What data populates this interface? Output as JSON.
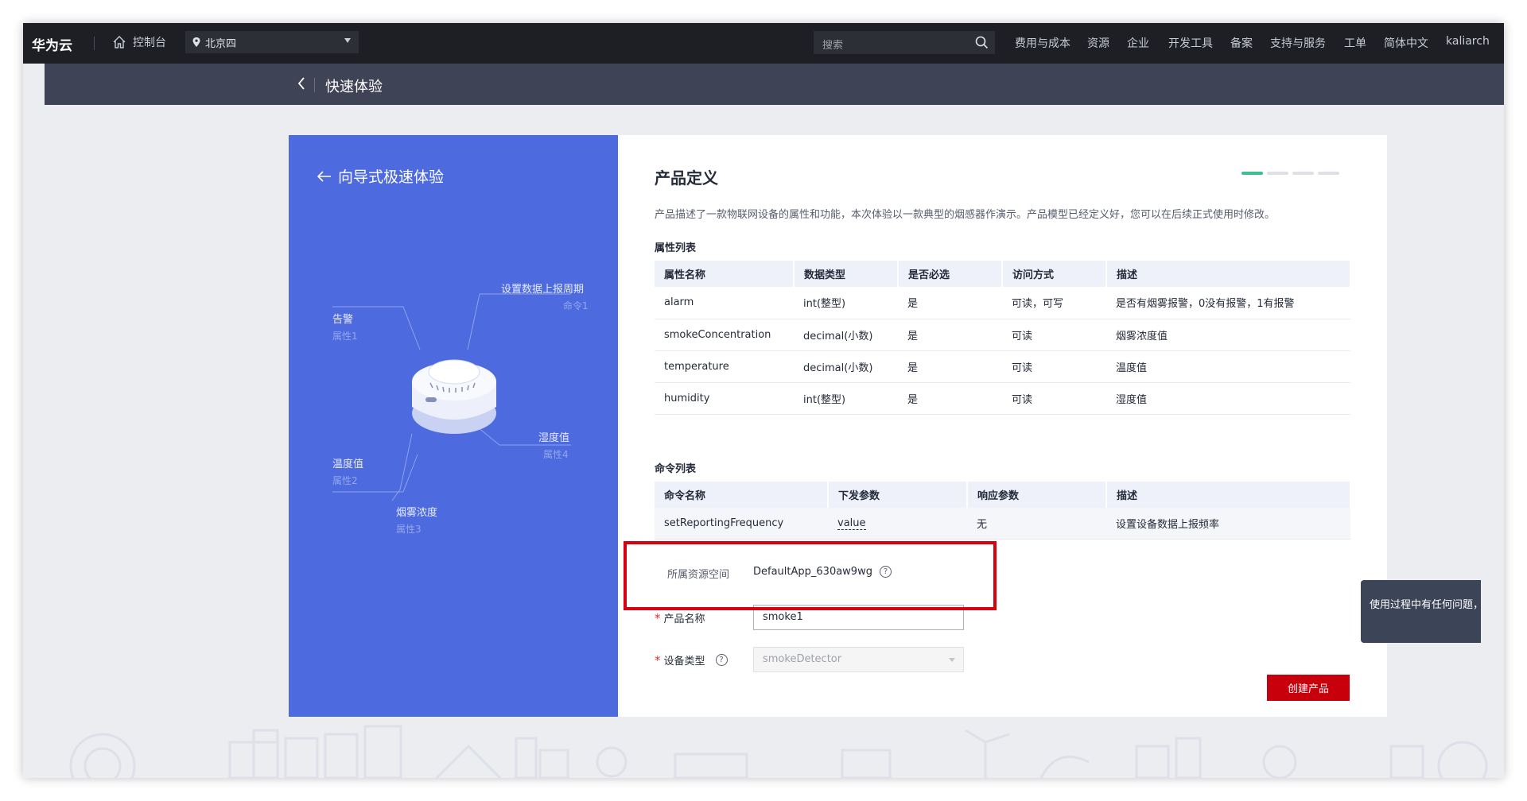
{
  "topbar": {
    "logo": "华为云",
    "console": "控制台",
    "region": "北京四",
    "search_placeholder": "搜索",
    "nav": [
      "费用与成本",
      "资源",
      "企业",
      "开发工具",
      "备案",
      "支持与服务",
      "工单",
      "简体中文",
      "kaliarch"
    ]
  },
  "subbar": {
    "title": "快速体验"
  },
  "left": {
    "title": "向导式极速体验",
    "diagram": {
      "set_period": "设置数据上报周期",
      "cmd1": "命令1",
      "alarm": "告警",
      "attr1": "属性1",
      "humidity": "湿度值",
      "attr4": "属性4",
      "temperature": "温度值",
      "attr2": "属性2",
      "smoke": "烟雾浓度",
      "attr3": "属性3"
    }
  },
  "product": {
    "title": "产品定义",
    "description": "产品描述了一款物联网设备的属性和功能，本次体验以一款典型的烟感器作演示。产品模型已经定义好，您可以在后续正式使用时修改。",
    "attr_section": "属性列表",
    "attr_headers": [
      "属性名称",
      "数据类型",
      "是否必选",
      "访问方式",
      "描述"
    ],
    "attr_rows": [
      [
        "alarm",
        "int(整型)",
        "是",
        "可读，可写",
        "是否有烟雾报警，0没有报警，1有报警"
      ],
      [
        "smokeConcentration",
        "decimal(小数)",
        "是",
        "可读",
        "烟雾浓度值"
      ],
      [
        "temperature",
        "decimal(小数)",
        "是",
        "可读",
        "温度值"
      ],
      [
        "humidity",
        "int(整型)",
        "是",
        "可读",
        "湿度值"
      ]
    ],
    "cmd_section": "命令列表",
    "cmd_headers": [
      "命令名称",
      "下发参数",
      "响应参数",
      "描述"
    ],
    "cmd_rows": [
      [
        "setReportingFrequency",
        "value",
        "无",
        "设置设备数据上报频率"
      ]
    ]
  },
  "form": {
    "resource_space_label": "所属资源空间",
    "resource_space_value": "DefaultApp_630aw9wg",
    "product_name_label": "产品名称",
    "product_name_value": "smoke1",
    "device_type_label": "设备类型",
    "device_type_value": "smokeDetector",
    "create_button": "创建产品"
  },
  "tooltip": "使用过程中有任何问题，智能",
  "colors": {
    "accent_red": "#c7000b",
    "panel_blue": "#4d6bde",
    "highlight": "#d7000f",
    "step_active": "#3fbf8f"
  }
}
